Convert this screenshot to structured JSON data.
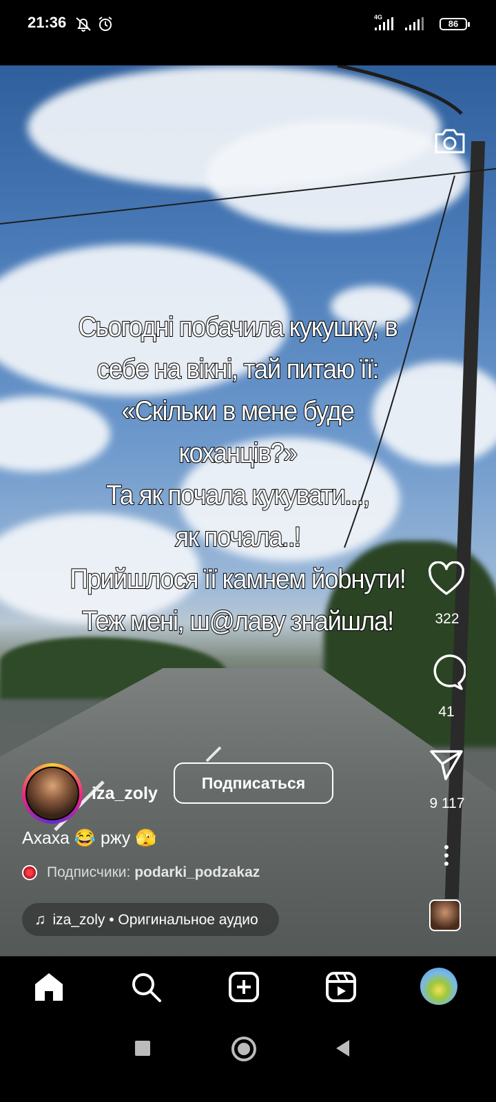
{
  "status_bar": {
    "time": "21:36",
    "network_label": "4G",
    "battery": "86",
    "icons": [
      "bell-off-icon",
      "alarm-icon",
      "signal-4g-icon",
      "signal-icon",
      "battery-icon"
    ]
  },
  "reel": {
    "overlay_lines": [
      "Сьогодні побачила кукушку, в",
      "себе на вікні, тай питаю її:",
      "«Скільки в мене буде",
      "коханців?»",
      "Та як почала кукувати...,",
      "як почала..!",
      "Прийшлося її камнем йоbнути!",
      "Теж мені, ш@лаву знайшла!"
    ],
    "likes": "322",
    "comments": "41",
    "shares": "9 117"
  },
  "author": {
    "username": "iza_zoly",
    "follow_label": "Подписаться"
  },
  "caption": "Ахаха 😂 ржу 🫣",
  "subscribers": {
    "label": "Подписчики:",
    "account": "podarki_podzakaz"
  },
  "audio": {
    "text": "iza_zoly • Оригинальное аудио"
  },
  "bottom_nav": [
    "home-icon",
    "search-icon",
    "create-icon",
    "reels-icon",
    "profile-avatar"
  ],
  "colors": {
    "background": "#000000",
    "text": "#ffffff",
    "ring_gradient": [
      "#f9ce34",
      "#ee2a7b",
      "#6228d7"
    ]
  }
}
